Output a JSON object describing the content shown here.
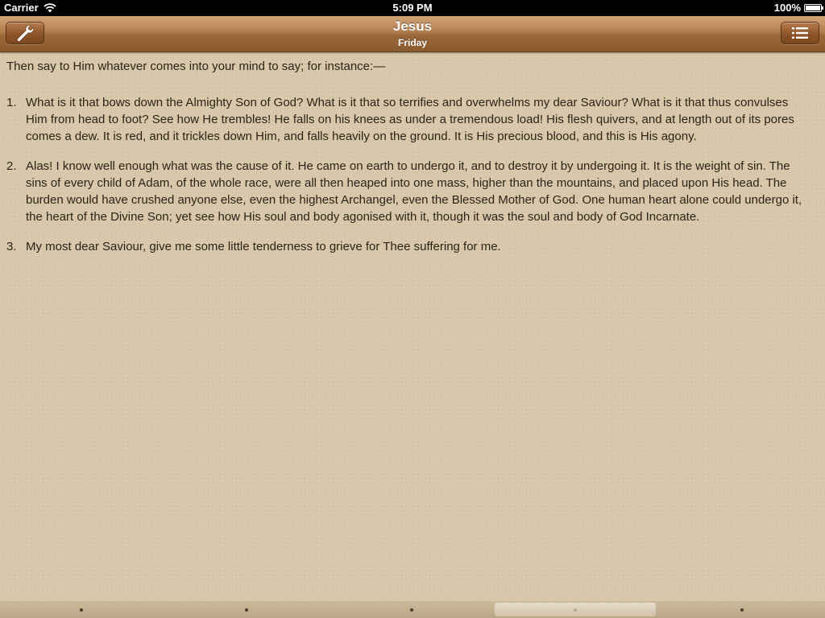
{
  "status_bar": {
    "carrier": "Carrier",
    "time": "5:09 PM",
    "battery": "100%",
    "battery_level": 1.0,
    "wifi_icon": "wifi-icon"
  },
  "nav_bar": {
    "title": "Jesus",
    "subtitle": "Friday",
    "left_icon": "wrench-icon",
    "right_icon": "list-icon"
  },
  "content": {
    "intro": "Then say to Him whatever comes into your mind to say; for instance:—",
    "points": [
      {
        "number": "1.",
        "text": "What is it that bows down the Almighty Son of God? What is it that so terrifies and overwhelms my dear Saviour? What is it that thus convulses Him from head to foot? See how He trembles! He falls on his knees as under a tremendous load! His flesh quivers, and at length out of its pores comes a dew. It is red, and it trickles down Him, and falls heavily on the ground. It is His precious blood, and this is His agony."
      },
      {
        "number": "2.",
        "text": "Alas! I know well enough what was the cause of it. He came on earth to undergo it, and to destroy it by undergoing it. It is the weight of sin. The sins of every child of Adam, of the whole race, were all then heaped into one mass, higher than the mountains, and placed upon His head. The burden would have crushed anyone else, even the highest Archangel, even the Blessed Mother of God. One human heart alone could undergo it, the heart of the Divine Son; yet see how His soul and body agonised with it, though it was the soul and body of God Incarnate."
      },
      {
        "number": "3.",
        "text": "My most dear Saviour, give me some little tenderness to grieve for Thee suffering for me."
      }
    ]
  },
  "page_bar": {
    "page_count": 5,
    "current_page": 4
  },
  "colors": {
    "background": "#d8c7a9",
    "nav_bar": "#a8764a",
    "text": "#2a2418"
  }
}
